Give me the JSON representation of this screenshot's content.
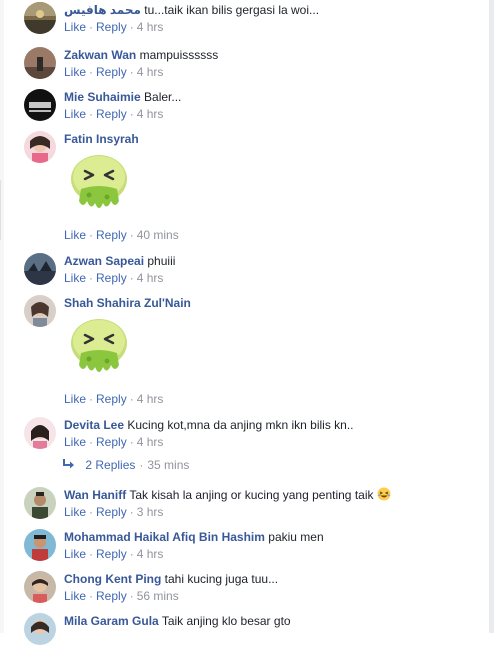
{
  "labels": {
    "like": "Like",
    "reply": "Reply",
    "separator": "·"
  },
  "comments": [
    {
      "name": "محمد هافيس",
      "text": "tu...taik ikan bilis gergasi la woi...",
      "time": "4 hrs"
    },
    {
      "name": "Zakwan Wan",
      "text": "mampuissssss",
      "time": "4 hrs"
    },
    {
      "name": "Mie Suhaimie",
      "text": "Baler...",
      "time": "4 hrs"
    },
    {
      "name": "Fatin Insyrah",
      "text": "",
      "time": "40 mins",
      "sticker": "vomit-sticker"
    },
    {
      "name": "Azwan Sapeai",
      "text": "phuiii",
      "time": "4 hrs"
    },
    {
      "name": "Shah Shahira Zul'Nain",
      "text": "",
      "time": "4 hrs",
      "sticker": "vomit-sticker"
    },
    {
      "name": "Devita Lee",
      "text": "Kucing kot,mna da anjing mkn ikn bilis kn..",
      "time": "4 hrs"
    },
    {
      "name": "Wan Haniff",
      "text": "Tak kisah la anjing or kucing yang penting taik",
      "time": "3 hrs",
      "emoji": "laughing-emoji"
    },
    {
      "name": "Mohammad Haikal Afiq Bin Hashim",
      "text": "pakiu men",
      "time": "4 hrs"
    },
    {
      "name": "Chong Kent Ping",
      "text": "tahi kucing juga tuu...",
      "time": "56 mins"
    },
    {
      "name": "Mila Garam Gula",
      "text": "Taik anjing klo besar gto",
      "time": ""
    }
  ],
  "replies_summary": {
    "label": "2 Replies",
    "time": "35 mins"
  },
  "colors": {
    "name": "#385898",
    "link": "#4267b2",
    "meta": "#90949c",
    "text": "#1d2129"
  }
}
